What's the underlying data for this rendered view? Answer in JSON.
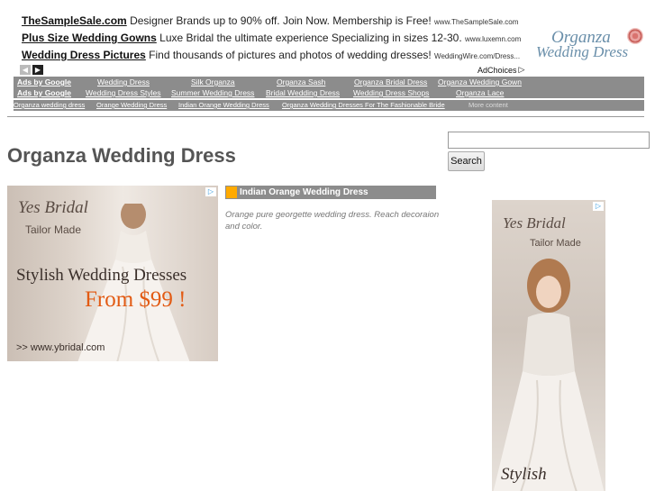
{
  "text_ads": [
    {
      "title": "TheSampleSale.com",
      "text": "Designer Brands up to 90% off. Join Now. Membership is Free!",
      "url": "www.TheSampleSale.com"
    },
    {
      "title": "Plus Size Wedding Gowns",
      "text": "Luxe Bridal the ultimate experience Specializing in sizes 12-30.",
      "url": "www.luxemn.com"
    },
    {
      "title": "Wedding Dress Pictures",
      "text": "Find thousands of pictures and photos of wedding dresses!",
      "url": "WeddingWire.com/Dress..."
    }
  ],
  "logo": {
    "line1": "Organza",
    "line2": "Wedding Dress"
  },
  "adchoices": "AdChoices",
  "link_bar": {
    "ads_by": "Ads by Google",
    "row1": [
      "Wedding Dress",
      "Silk Organza",
      "Organza Sash",
      "Organza Bridal Dress",
      "Organza Wedding Gown"
    ],
    "row2": [
      "Wedding Dress Styles",
      "Summer Wedding Dress",
      "Bridal Wedding Dress",
      "Wedding Dress Shops",
      "Organza Lace"
    ]
  },
  "tags": [
    "Organza wedding dress",
    "Orange Wedding Dress",
    "Indian Orange Wedding Dress",
    "Organza Wedding Dresses For The Fashionable Bride"
  ],
  "tags_more": "More content",
  "page_title": "Organza Wedding Dress",
  "search": {
    "placeholder": "",
    "button": "Search"
  },
  "banner_ad": {
    "brand": "Yes Bridal",
    "tagline": "Tailor Made",
    "headline": "Stylish Wedding Dresses",
    "price": "From $99 !",
    "url": ">> www.ybridal.com"
  },
  "article": {
    "title": "Indian Orange Wedding Dress",
    "text": "Orange pure georgette wedding dress. Reach decoraion and color."
  },
  "sky_ad": {
    "brand": "Yes Bridal",
    "tagline": "Tailor Made",
    "headline": "Stylish"
  },
  "colors": {
    "bar": "#8c8c8c",
    "accent": "#ffaa00",
    "price": "#e25b14",
    "logo": "#6a8faa"
  }
}
